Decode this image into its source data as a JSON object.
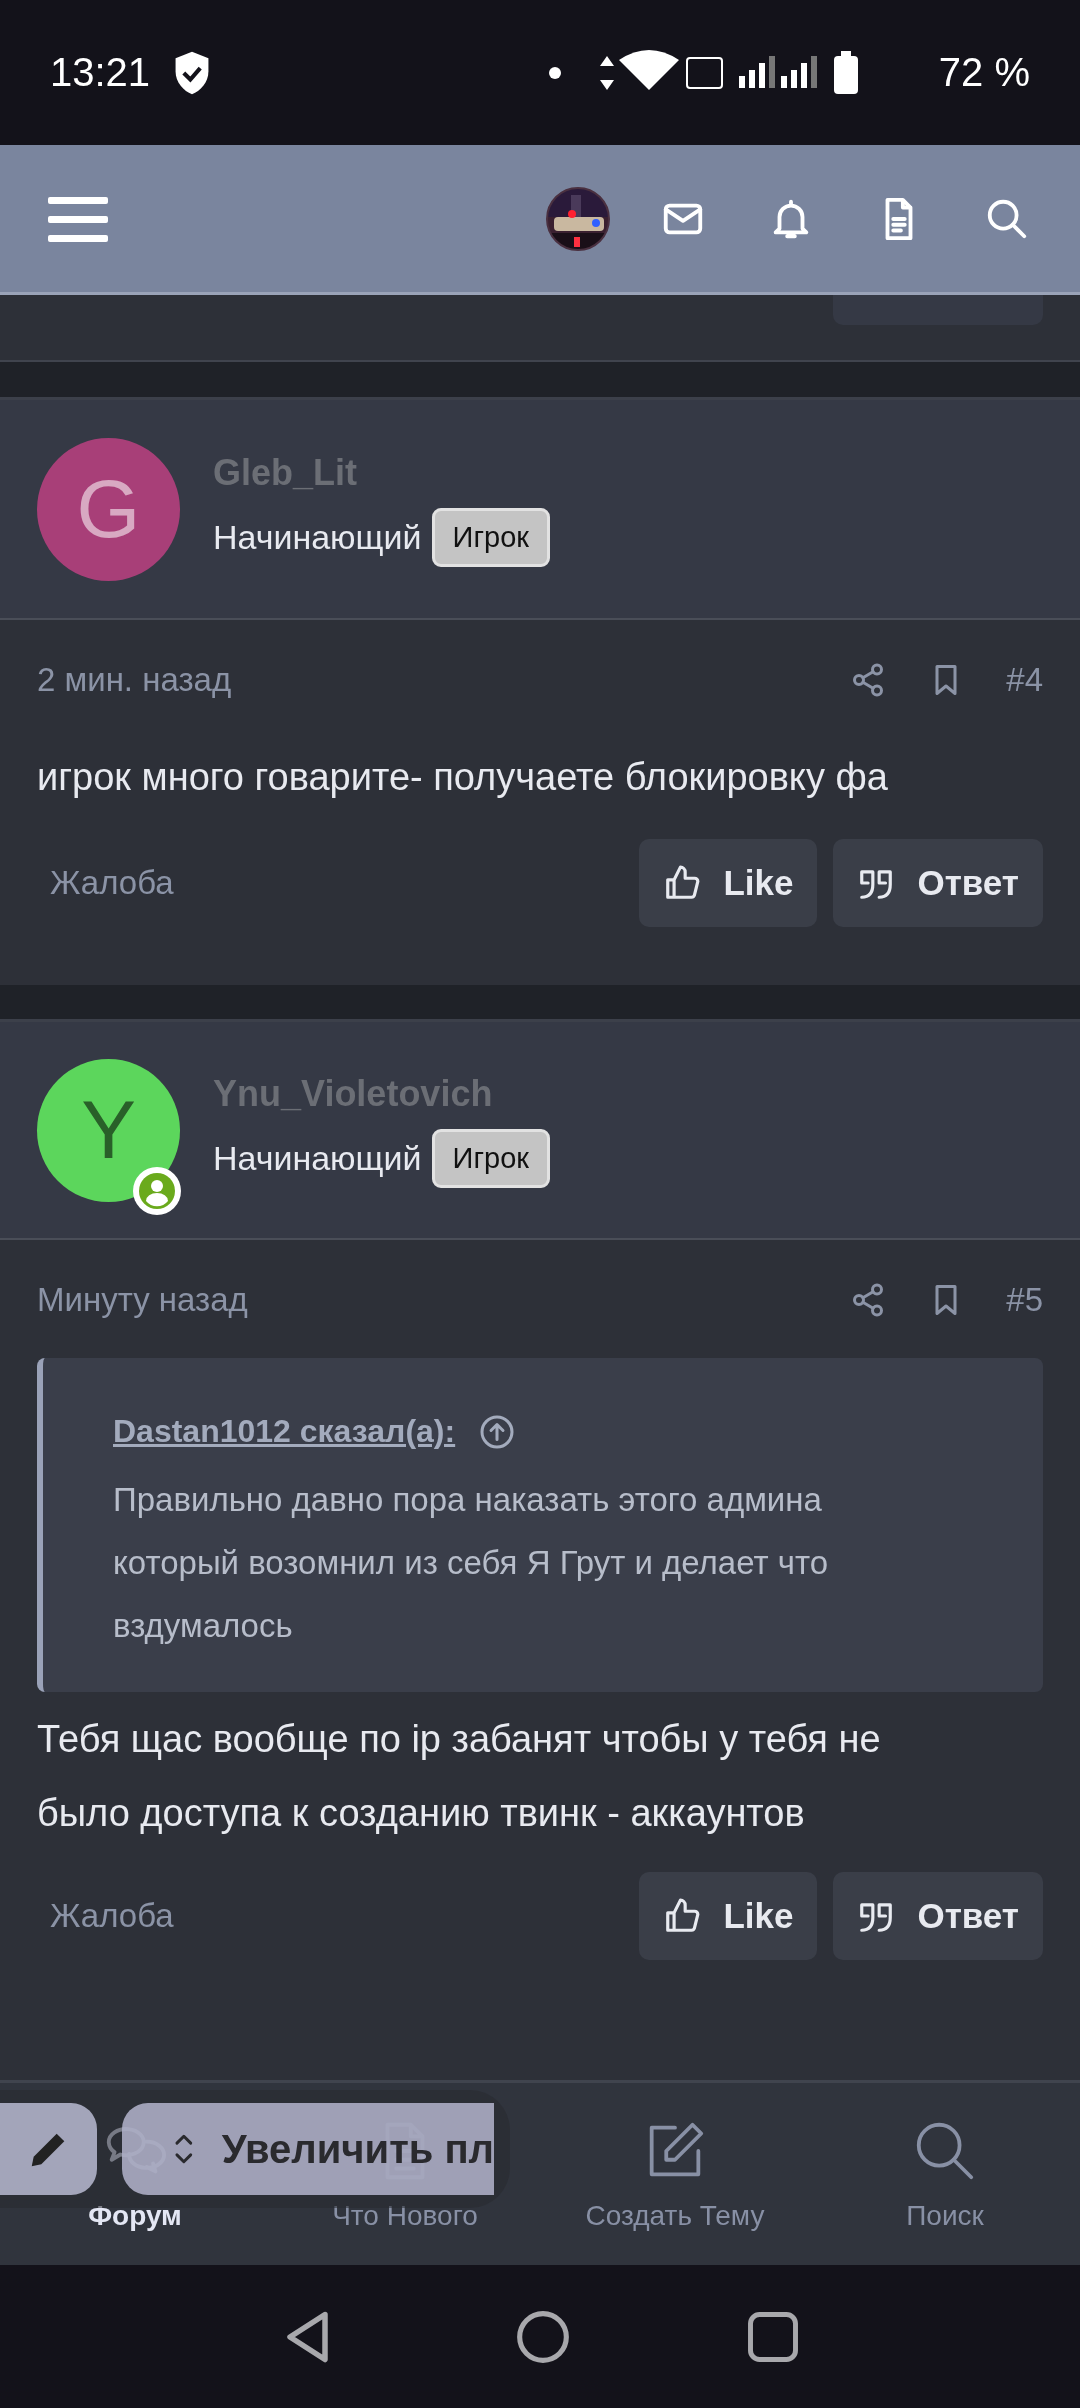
{
  "status_bar": {
    "time": "13:21",
    "battery": "72 %"
  },
  "posts": [
    {
      "author": {
        "name": "Gleb_Lit",
        "initial": "G",
        "color": "#a83f78",
        "online": false,
        "rank": "Начинающий",
        "badge": "Игрок"
      },
      "time": "2 мин. назад",
      "number": "#4",
      "text": "игрок много говарите- получаете блокировку фа",
      "report": "Жалоба",
      "like": "Like",
      "reply": "Ответ"
    },
    {
      "author": {
        "name": "Ynu_Violetovich",
        "initial": "Y",
        "color": "#5cd65c",
        "online": true,
        "rank": "Начинающий",
        "badge": "Игрок"
      },
      "time": "Минуту назад",
      "number": "#5",
      "quote": {
        "author": "Dastan1012 сказал(а):",
        "text": "Правильно давно пора наказать этого админа который возомнил из себя Я Грут и делает что вздумалось"
      },
      "text": "Тебя щас вообще по ip забанят чтобы у тебя не было доступа к созданию твинк - аккаунтов",
      "report": "Жалоба",
      "like": "Like",
      "reply": "Ответ"
    }
  ],
  "bottom_nav": [
    {
      "kind": "forum",
      "label": "Форум",
      "selected": true
    },
    {
      "kind": "new",
      "label": "Что Нового",
      "selected": false
    },
    {
      "kind": "create",
      "label": "Создать Тему",
      "selected": false
    },
    {
      "kind": "search",
      "label": "Поиск",
      "selected": false
    }
  ],
  "zoom_overlay": {
    "label": "Увеличить пл"
  }
}
